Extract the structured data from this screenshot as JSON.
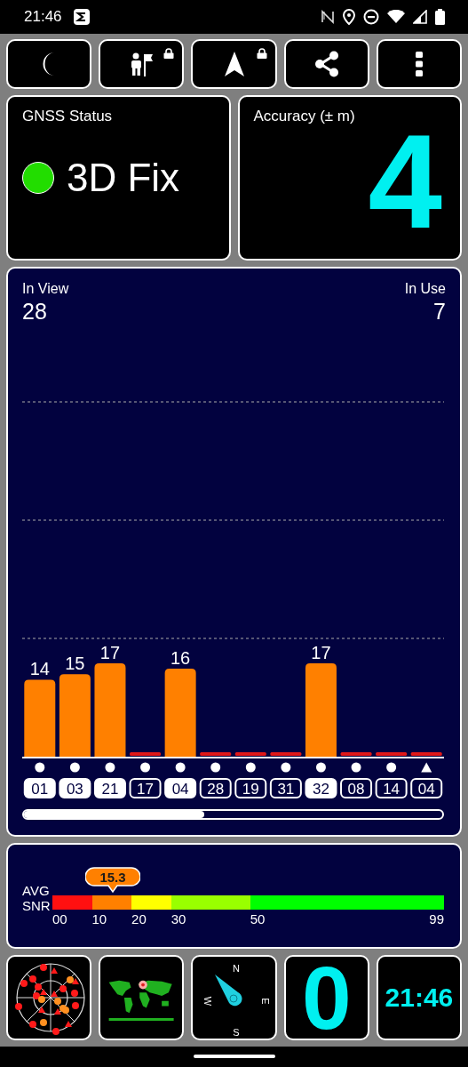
{
  "status_bar": {
    "time": "21:46"
  },
  "toolbar": [
    {
      "kind": "night",
      "locked": false
    },
    {
      "kind": "explorer",
      "locked": true
    },
    {
      "kind": "navigate",
      "locked": true
    },
    {
      "kind": "share",
      "locked": false
    },
    {
      "kind": "menu",
      "locked": false
    }
  ],
  "gnss_status": {
    "title": "GNSS Status",
    "color": "#22dd00",
    "fix": "3D Fix"
  },
  "accuracy": {
    "title": "Accuracy (± m)",
    "value": "4"
  },
  "signal_panel": {
    "in_view_label": "In View",
    "in_view": "28",
    "in_use_label": "In Use",
    "in_use": "7",
    "chart_data": {
      "type": "bar",
      "categories": [
        "01",
        "03",
        "21",
        "17",
        "04",
        "28",
        "19",
        "31",
        "32",
        "08",
        "14",
        "04"
      ],
      "values": [
        14,
        15,
        17,
        null,
        16,
        null,
        null,
        null,
        17,
        null,
        null,
        null
      ],
      "data_labels": true
    },
    "satellites": [
      {
        "in_use": true,
        "kind": "dot"
      },
      {
        "in_use": true,
        "kind": "dot"
      },
      {
        "in_use": true,
        "kind": "dot"
      },
      {
        "in_use": false,
        "kind": "dot"
      },
      {
        "in_use": true,
        "kind": "dot"
      },
      {
        "in_use": false,
        "kind": "dot"
      },
      {
        "in_use": false,
        "kind": "dot"
      },
      {
        "in_use": false,
        "kind": "dot"
      },
      {
        "in_use": true,
        "kind": "dot"
      },
      {
        "in_use": false,
        "kind": "dot"
      },
      {
        "in_use": false,
        "kind": "dot"
      },
      {
        "in_use": false,
        "kind": "triangle"
      }
    ]
  },
  "avg_snr": {
    "label": "AVG",
    "sublabel": "SNR",
    "value": "15.3",
    "level": 0.155,
    "segments": [
      {
        "tick": "00",
        "color": "#ff1010"
      },
      {
        "tick": "10",
        "color": "#ff8000"
      },
      {
        "tick": "20",
        "color": "#ffff00"
      },
      {
        "tick": "30",
        "color": "#99ff00"
      },
      {
        "tick": "50",
        "color": "#00ff00"
      }
    ],
    "end_tick": "99"
  },
  "tiles": [
    {
      "kind": "radar"
    },
    {
      "kind": "map"
    },
    {
      "kind": "compass",
      "north": "N",
      "east": "E",
      "south": "S",
      "west": "W"
    },
    {
      "kind": "counter",
      "value": "0"
    },
    {
      "kind": "clock",
      "value": "21:46"
    }
  ]
}
